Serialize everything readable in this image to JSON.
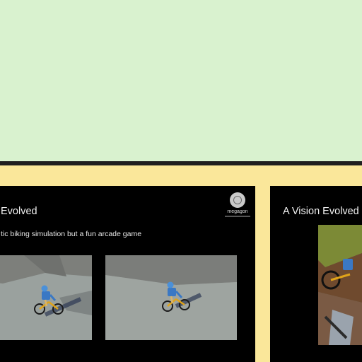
{
  "slides": [
    {
      "title": "Evolved",
      "subtitle": "tic biking simulation but a fun arcade game",
      "logo": {
        "text": "megagon",
        "icon": "megagon-logo-icon"
      }
    },
    {
      "title": "A Vision Evolved"
    }
  ],
  "colors": {
    "top_pane": "#d9f2cf",
    "divider": "#1f1f1f",
    "strip": "#fae79a",
    "slide_bg": "#000000"
  }
}
